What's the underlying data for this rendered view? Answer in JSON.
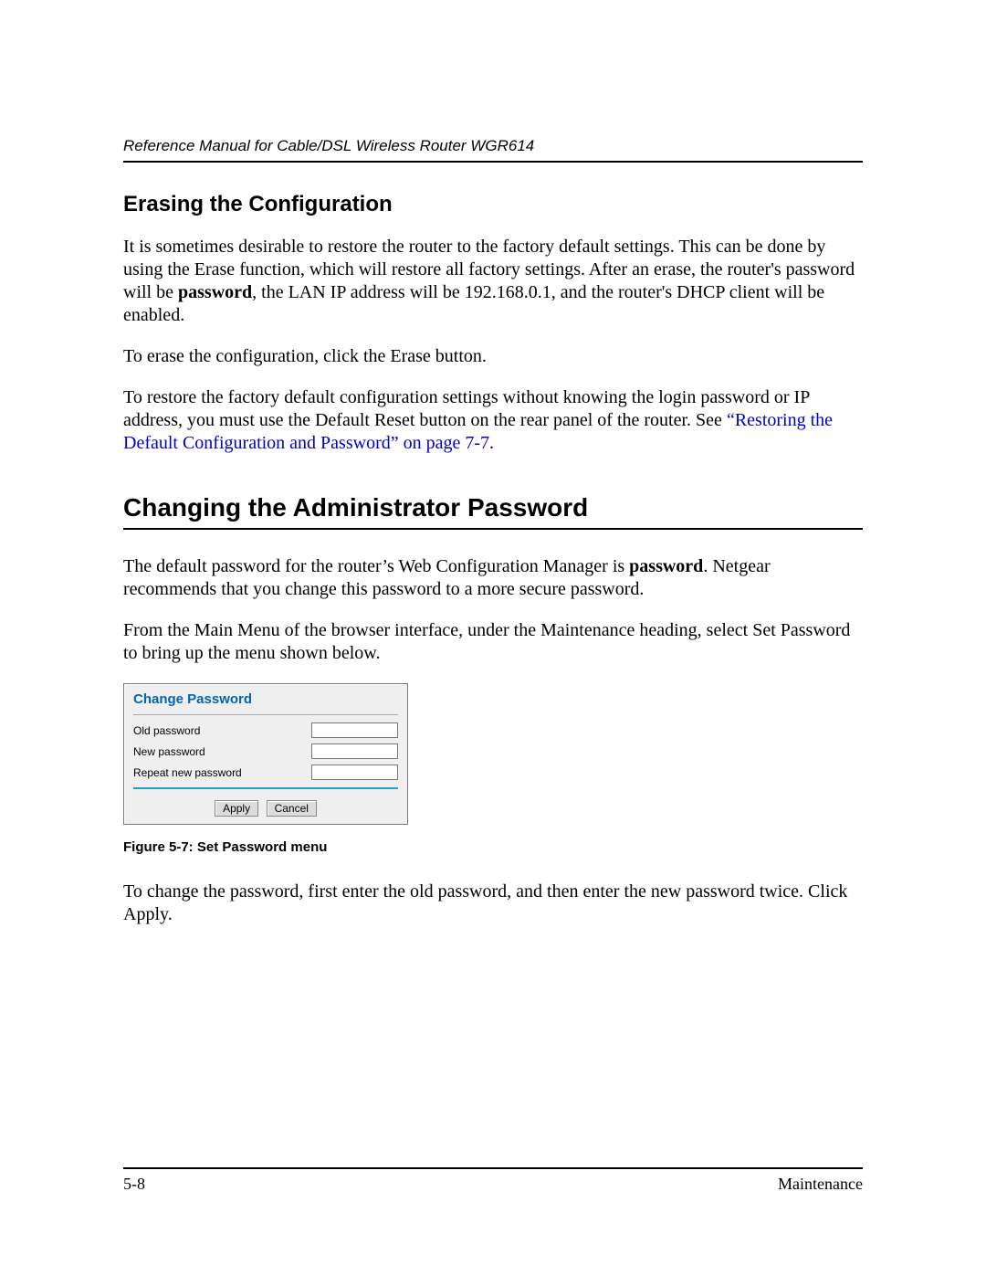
{
  "header": {
    "running_title": "Reference Manual for Cable/DSL Wireless Router WGR614"
  },
  "section1": {
    "heading": "Erasing the Configuration",
    "p1_a": "It is sometimes desirable to restore the router to the factory default settings. This can be done by using the Erase function, which will restore all factory settings. After an erase, the router's password will be ",
    "p1_bold": "password",
    "p1_b": ", the LAN IP address will be 192.168.0.1, and the router's DHCP client will be enabled.",
    "p2": "To erase the configuration, click the Erase button.",
    "p3_a": "To restore the factory default configuration settings without knowing the login password or IP address, you must use the Default Reset button on the rear panel of the router. See ",
    "p3_link": "“Restoring the Default Configuration and Password” on page 7-7",
    "p3_b": "."
  },
  "section2": {
    "heading": "Changing the Administrator Password",
    "p1_a": "The default password for the router’s Web Configuration Manager is ",
    "p1_bold": "password",
    "p1_b": ". Netgear recommends that you change this password to a more secure password.",
    "p2": "From the Main Menu of the browser interface, under the Maintenance heading, select Set Password to bring up the menu shown below."
  },
  "panel": {
    "title": "Change Password",
    "rows": {
      "old": "Old password",
      "new": "New password",
      "repeat": "Repeat new password"
    },
    "values": {
      "old": "",
      "new": "",
      "repeat": ""
    },
    "buttons": {
      "apply": "Apply",
      "cancel": "Cancel"
    }
  },
  "figure": {
    "caption": "Figure 5-7:  Set Password menu"
  },
  "after_figure": {
    "p1": "To change the password, first enter the old password, and then enter the new password twice. Click Apply."
  },
  "footer": {
    "page": "5-8",
    "section": "Maintenance"
  }
}
